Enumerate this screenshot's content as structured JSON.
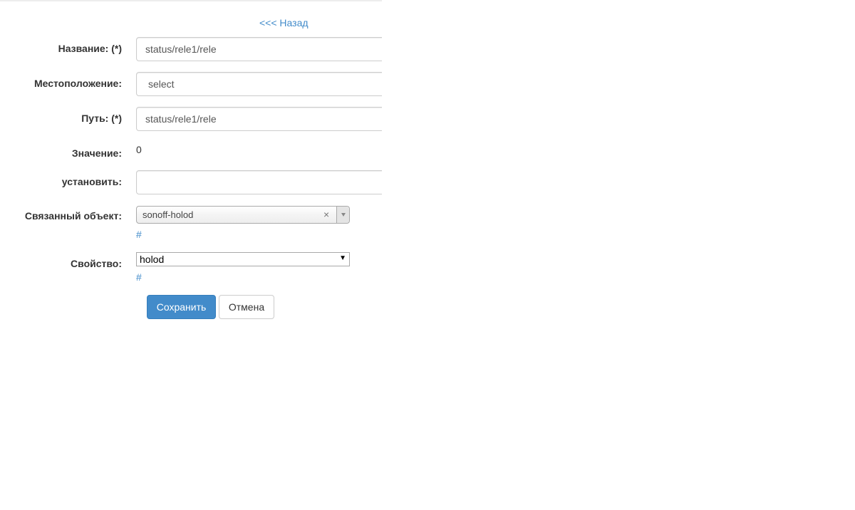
{
  "nav": {
    "back_label": "<<< Назад"
  },
  "form": {
    "title": {
      "label": "Название: (*)",
      "value": "status/rele1/rele"
    },
    "location": {
      "label": "Местоположение:",
      "value": "select"
    },
    "path": {
      "label": "Путь: (*)",
      "value": "status/rele1/rele"
    },
    "current_value": {
      "label": "Значение:",
      "value": "0"
    },
    "set": {
      "label": "установить:",
      "value": ""
    },
    "linked_object": {
      "label": "Связанный объект:",
      "value": "sonoff-holod",
      "link": "#"
    },
    "property": {
      "label": "Свойство:",
      "value": "holod",
      "link": "#"
    }
  },
  "actions": {
    "save_label": "Сохранить",
    "cancel_label": "Отмена"
  },
  "colors": {
    "accent": "#428bca",
    "text": "#333333",
    "border": "#cccccc"
  },
  "icons": {
    "clear": "close-icon",
    "dropdown": "chevron-down-icon"
  }
}
